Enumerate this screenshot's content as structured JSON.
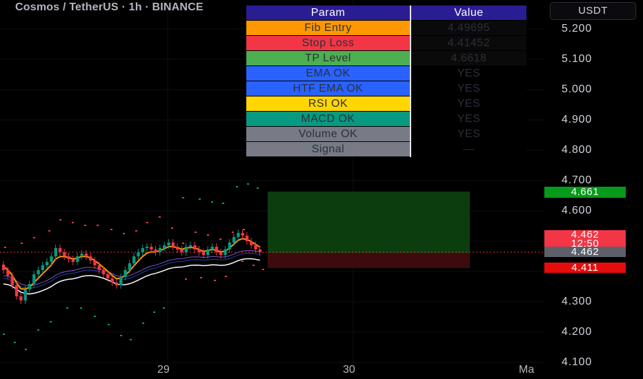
{
  "header": {
    "symbol_title": "Cosmos / TetherUS · 1h · BINANCE",
    "currency": "USDT"
  },
  "price_axis": {
    "labels": [
      "5.200",
      "5.100",
      "5.000",
      "4.900",
      "4.800",
      "4.700",
      "4.600",
      "4.300",
      "4.200",
      "4.100"
    ]
  },
  "time_axis": {
    "labels": [
      "29",
      "30",
      "Ma"
    ]
  },
  "price_tags": {
    "tp": "4.661",
    "current": "4.462",
    "countdown": "12:50",
    "last": "4.462",
    "sl": "4.411"
  },
  "table": {
    "header": {
      "param": "Param",
      "value": "Value"
    },
    "rows": [
      {
        "label": "Fib Entry",
        "value": "4.49695",
        "bg": "#ff9800"
      },
      {
        "label": "Stop Loss",
        "value": "4.41452",
        "bg": "#f23645"
      },
      {
        "label": "TP Level",
        "value": "4.6618",
        "bg": "#4caf50"
      },
      {
        "label": "EMA OK",
        "value": "YES",
        "bg": "#2962ff"
      },
      {
        "label": "HTF EMA OK",
        "value": "YES",
        "bg": "#2962ff"
      },
      {
        "label": "RSI OK",
        "value": "YES",
        "bg": "#ffd600"
      },
      {
        "label": "MACD OK",
        "value": "YES",
        "bg": "#089981"
      },
      {
        "label": "Volume OK",
        "value": "YES",
        "bg": "#787b86"
      },
      {
        "label": "Signal",
        "value": "—",
        "bg": "#787b86"
      }
    ]
  },
  "colors": {
    "bull": "#089981",
    "bear": "#f23645",
    "ema_fast": "#ff9800",
    "ema_slow": "#ffffff",
    "tp_zone": "#0b3d0f",
    "sl_zone": "#3d0b0b",
    "tag_green": "#089a1b",
    "tag_red": "#f23645",
    "tag_gray": "#5d606b",
    "tag_sl": "#e50c0c"
  }
}
